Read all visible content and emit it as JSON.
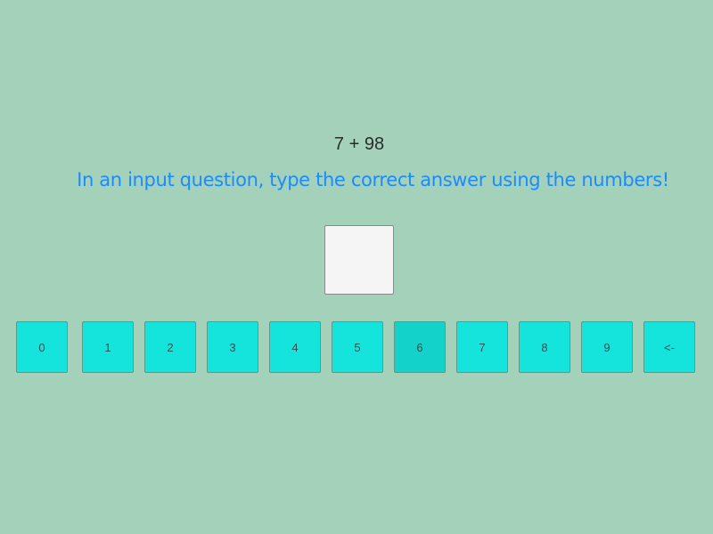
{
  "question": {
    "text": "7 + 98"
  },
  "instruction": {
    "text": "In an input question, type the correct answer using the numbers!"
  },
  "answer": {
    "value": ""
  },
  "keypad": {
    "keys": [
      "0",
      "1",
      "2",
      "3",
      "4",
      "5",
      "6",
      "7",
      "8",
      "9",
      "<-"
    ],
    "hovered_key": "6"
  },
  "colors": {
    "background": "#a4d1b9",
    "key": "#14e4dc",
    "key_hover": "#12d2c9",
    "instruction": "#1a8cff",
    "answer_box": "#f5f5f5"
  }
}
